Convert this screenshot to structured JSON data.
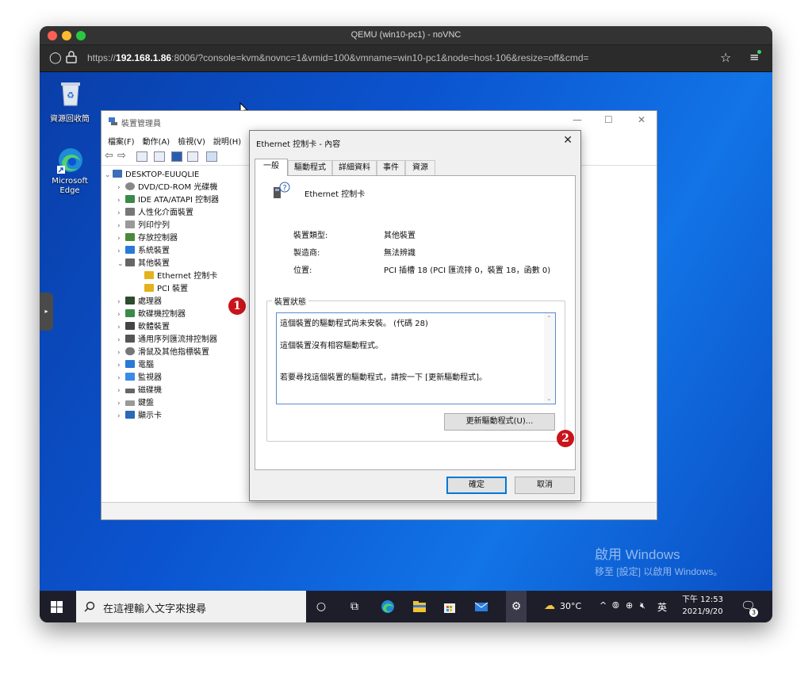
{
  "browser": {
    "window_title": "QEMU (win10-pc1) - noVNC",
    "url_prefix": "https://",
    "url_host": "192.168.1.86",
    "url_rest": ":8006/?console=kvm&novnc=1&vmid=100&vmname=win10-pc1&node=host-106&resize=off&cmd="
  },
  "desktop": {
    "icons": [
      {
        "label": "資源回收筒",
        "icon": "recycle-bin-icon"
      },
      {
        "label": "Microsoft Edge",
        "icon": "edge-icon"
      }
    ],
    "watermark_title": "啟用 Windows",
    "watermark_sub": "移至 [設定] 以啟用 Windows。"
  },
  "device_manager": {
    "title": "裝置管理員",
    "menu": [
      "檔案(F)",
      "動作(A)",
      "檢視(V)",
      "說明(H)"
    ],
    "tree": {
      "root": "DESKTOP-EUUQLIE",
      "items": [
        {
          "label": "DVD/CD-ROM 光碟機",
          "expanded": false
        },
        {
          "label": "IDE ATA/ATAPI 控制器",
          "expanded": false
        },
        {
          "label": "人性化介面裝置",
          "expanded": false
        },
        {
          "label": "列印佇列",
          "expanded": false
        },
        {
          "label": "存放控制器",
          "expanded": false
        },
        {
          "label": "系統裝置",
          "expanded": false
        },
        {
          "label": "其他裝置",
          "expanded": true,
          "children": [
            "Ethernet 控制卡",
            "PCI 裝置"
          ]
        },
        {
          "label": "處理器",
          "expanded": false
        },
        {
          "label": "軟碟機控制器",
          "expanded": false
        },
        {
          "label": "軟體裝置",
          "expanded": false
        },
        {
          "label": "通用序列匯流排控制器",
          "expanded": false
        },
        {
          "label": "滑鼠及其他指標裝置",
          "expanded": false
        },
        {
          "label": "電腦",
          "expanded": false
        },
        {
          "label": "監視器",
          "expanded": false
        },
        {
          "label": "磁碟機",
          "expanded": false
        },
        {
          "label": "鍵盤",
          "expanded": false
        },
        {
          "label": "顯示卡",
          "expanded": false
        }
      ]
    }
  },
  "properties": {
    "title": "Ethernet 控制卡 - 內容",
    "tabs": [
      "一般",
      "驅動程式",
      "詳細資料",
      "事件",
      "資源"
    ],
    "active_tab": "一般",
    "device_name": "Ethernet 控制卡",
    "fields": [
      {
        "label": "裝置類型:",
        "value": "其他裝置"
      },
      {
        "label": "製造商:",
        "value": "無法辨識"
      },
      {
        "label": "位置:",
        "value": "PCI 插槽 18 (PCI 匯流排 0，裝置 18，函數 0)"
      }
    ],
    "status_legend": "裝置狀態",
    "status_lines": [
      "這個裝置的驅動程式尚未安裝。 (代碼 28)",
      "這個裝置沒有相容驅動程式。",
      "若要尋找這個裝置的驅動程式，請按一下 [更新驅動程式]。"
    ],
    "update_driver_button": "更新驅動程式(U)...",
    "ok_button": "確定",
    "cancel_button": "取消"
  },
  "callouts": [
    "1",
    "2"
  ],
  "taskbar": {
    "search_placeholder": "在這裡輸入文字來搜尋",
    "weather": "30°C",
    "ime": "英",
    "time": "下午 12:53",
    "date": "2021/9/20",
    "notification_count": "3"
  }
}
